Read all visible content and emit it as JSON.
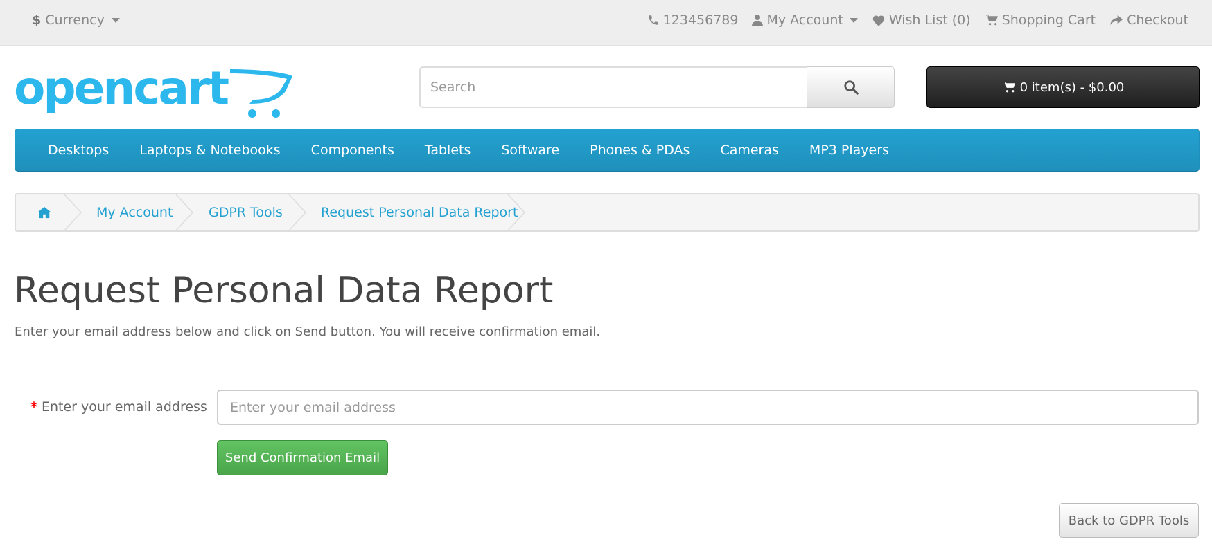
{
  "topbar": {
    "currency_symbol": "$",
    "currency_label": "Currency",
    "phone": "123456789",
    "my_account": "My Account",
    "wish_list": "Wish List (0)",
    "shopping_cart": "Shopping Cart",
    "checkout": "Checkout"
  },
  "header": {
    "logo_text": "opencart",
    "search_placeholder": "Search",
    "cart_label": "0 item(s) - $0.00"
  },
  "nav": {
    "items": [
      "Desktops",
      "Laptops & Notebooks",
      "Components",
      "Tablets",
      "Software",
      "Phones & PDAs",
      "Cameras",
      "MP3 Players"
    ]
  },
  "breadcrumb": {
    "items": [
      "My Account",
      "GDPR Tools",
      "Request Personal Data Report"
    ]
  },
  "main": {
    "title": "Request Personal Data Report",
    "intro": "Enter your email address below and click on Send button. You will receive confirmation email.",
    "required_mark": "*",
    "email_label": "Enter your email address",
    "email_placeholder": "Enter your email address",
    "send_button": "Send Confirmation Email",
    "back_button": "Back to GDPR Tools"
  },
  "colors": {
    "brand_blue": "#23a1d1",
    "logo_blue": "#2cb8ec",
    "send_green": "#5cb85c",
    "required_red": "#ff0000"
  }
}
